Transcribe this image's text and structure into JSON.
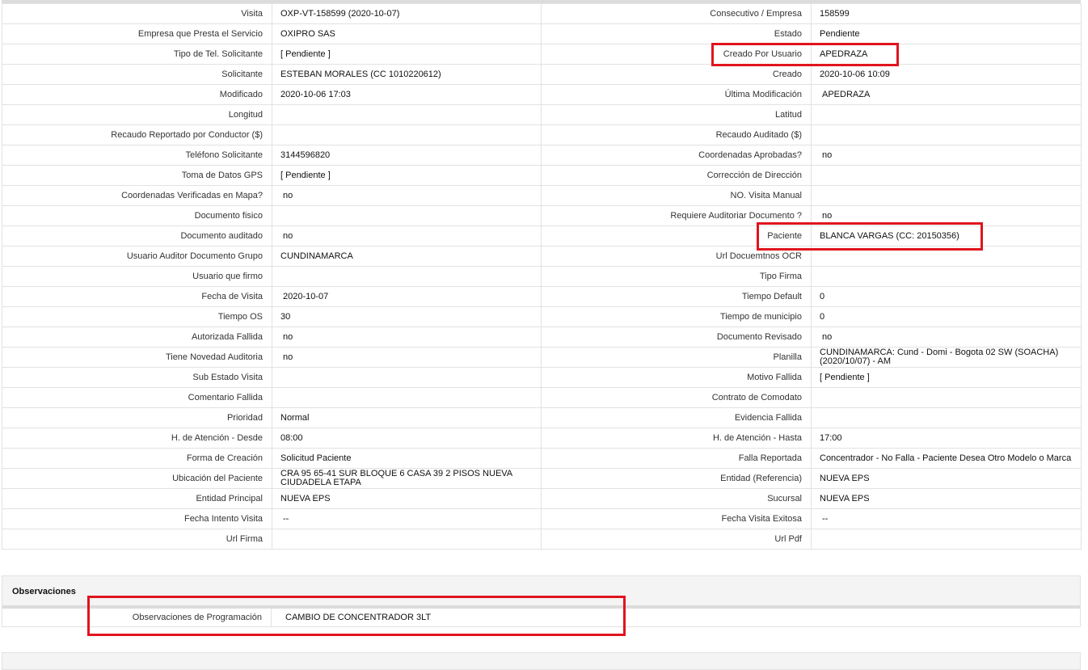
{
  "rows": [
    {
      "l1": "Visita",
      "v1": "OXP-VT-158599 (2020-10-07)",
      "l2": "Consecutivo / Empresa",
      "v2": "158599"
    },
    {
      "l1": "Empresa que Presta el Servicio",
      "v1": "OXIPRO SAS",
      "l2": "Estado",
      "v2": "Pendiente"
    },
    {
      "l1": "Tipo de Tel. Solicitante",
      "v1": "[ Pendiente ]",
      "l2": "Creado Por Usuario",
      "v2": "APEDRAZA"
    },
    {
      "l1": "Solicitante",
      "v1": "ESTEBAN MORALES (CC 1010220612)",
      "l2": "Creado",
      "v2": "2020-10-06 10:09"
    },
    {
      "l1": "Modificado",
      "v1": "2020-10-06 17:03",
      "l2": "Última Modificación",
      "v2": "APEDRAZA"
    },
    {
      "l1": "Longitud",
      "v1": "",
      "l2": "Latitud",
      "v2": ""
    },
    {
      "l1": "Recaudo Reportado por Conductor ($)",
      "v1": "",
      "l2": "Recaudo Auditado ($)",
      "v2": ""
    },
    {
      "l1": "Teléfono Solicitante",
      "v1": "3144596820",
      "l2": "Coordenadas Aprobadas?",
      "v2": "no"
    },
    {
      "l1": "Toma de Datos GPS",
      "v1": "[ Pendiente ]",
      "l2": "Corrección de Dirección",
      "v2": ""
    },
    {
      "l1": "Coordenadas Verificadas en Mapa?",
      "v1": "no",
      "l2": "NO. Visita Manual",
      "v2": ""
    },
    {
      "l1": "Documento fisico",
      "v1": "",
      "l2": "Requiere Auditoriar Documento ?",
      "v2": "no"
    },
    {
      "l1": "Documento auditado",
      "v1": "no",
      "l2": "Paciente",
      "v2": "BLANCA VARGAS (CC: 20150356)"
    },
    {
      "l1": "Usuario Auditor Documento Grupo",
      "v1": "CUNDINAMARCA",
      "l2": "Url Docuemtnos OCR",
      "v2": ""
    },
    {
      "l1": "Usuario que firmo",
      "v1": "",
      "l2": "Tipo Firma",
      "v2": ""
    },
    {
      "l1": "Fecha de Visita",
      "v1": "2020-10-07",
      "l2": "Tiempo Default",
      "v2": "0"
    },
    {
      "l1": "Tiempo OS",
      "v1": "30",
      "l2": "Tiempo de municipio",
      "v2": "0"
    },
    {
      "l1": "Autorizada Fallida",
      "v1": "no",
      "l2": "Documento Revisado",
      "v2": "no"
    },
    {
      "l1": "Tiene Novedad Auditoria",
      "v1": "no",
      "l2": "Planilla",
      "v2": "CUNDINAMARCA: Cund - Domi - Bogota 02 SW (SOACHA) (2020/10/07) - AM"
    },
    {
      "l1": "Sub Estado Visita",
      "v1": "",
      "l2": "Motivo Fallida",
      "v2": "[ Pendiente ]"
    },
    {
      "l1": "Comentario Fallida",
      "v1": "",
      "l2": "Contrato de Comodato",
      "v2": ""
    },
    {
      "l1": "Prioridad",
      "v1": "Normal",
      "l2": "Evidencia Fallida",
      "v2": ""
    },
    {
      "l1": "H. de Atención - Desde",
      "v1": "08:00",
      "l2": "H. de Atención - Hasta",
      "v2": "17:00"
    },
    {
      "l1": "Forma de Creación",
      "v1": "Solicitud Paciente",
      "l2": "Falla Reportada",
      "v2": "Concentrador - No Falla - Paciente Desea Otro Modelo o Marca"
    },
    {
      "l1": "Ubicación del Paciente",
      "v1": "CRA 95 65-41 SUR BLOQUE 6 CASA 39 2 PISOS NUEVA CIUDADELA ETAPA",
      "l2": "Entidad (Referencia)",
      "v2": "NUEVA EPS"
    },
    {
      "l1": "Entidad Principal",
      "v1": "NUEVA EPS",
      "l2": "Sucursal",
      "v2": "NUEVA EPS"
    },
    {
      "l1": "Fecha Intento Visita",
      "v1": "--",
      "l2": "Fecha Visita Exitosa",
      "v2": "--"
    },
    {
      "l1": "Url Firma",
      "v1": "",
      "l2": "Url Pdf",
      "v2": ""
    }
  ],
  "observaciones": {
    "title": "Observaciones",
    "label": "Observaciones de Programación",
    "value": "CAMBIO DE CONCENTRADOR 3LT"
  },
  "colors": {
    "highlight": "#e0141e",
    "border": "#e2e2e2",
    "section_bg": "#f4f4f4"
  }
}
